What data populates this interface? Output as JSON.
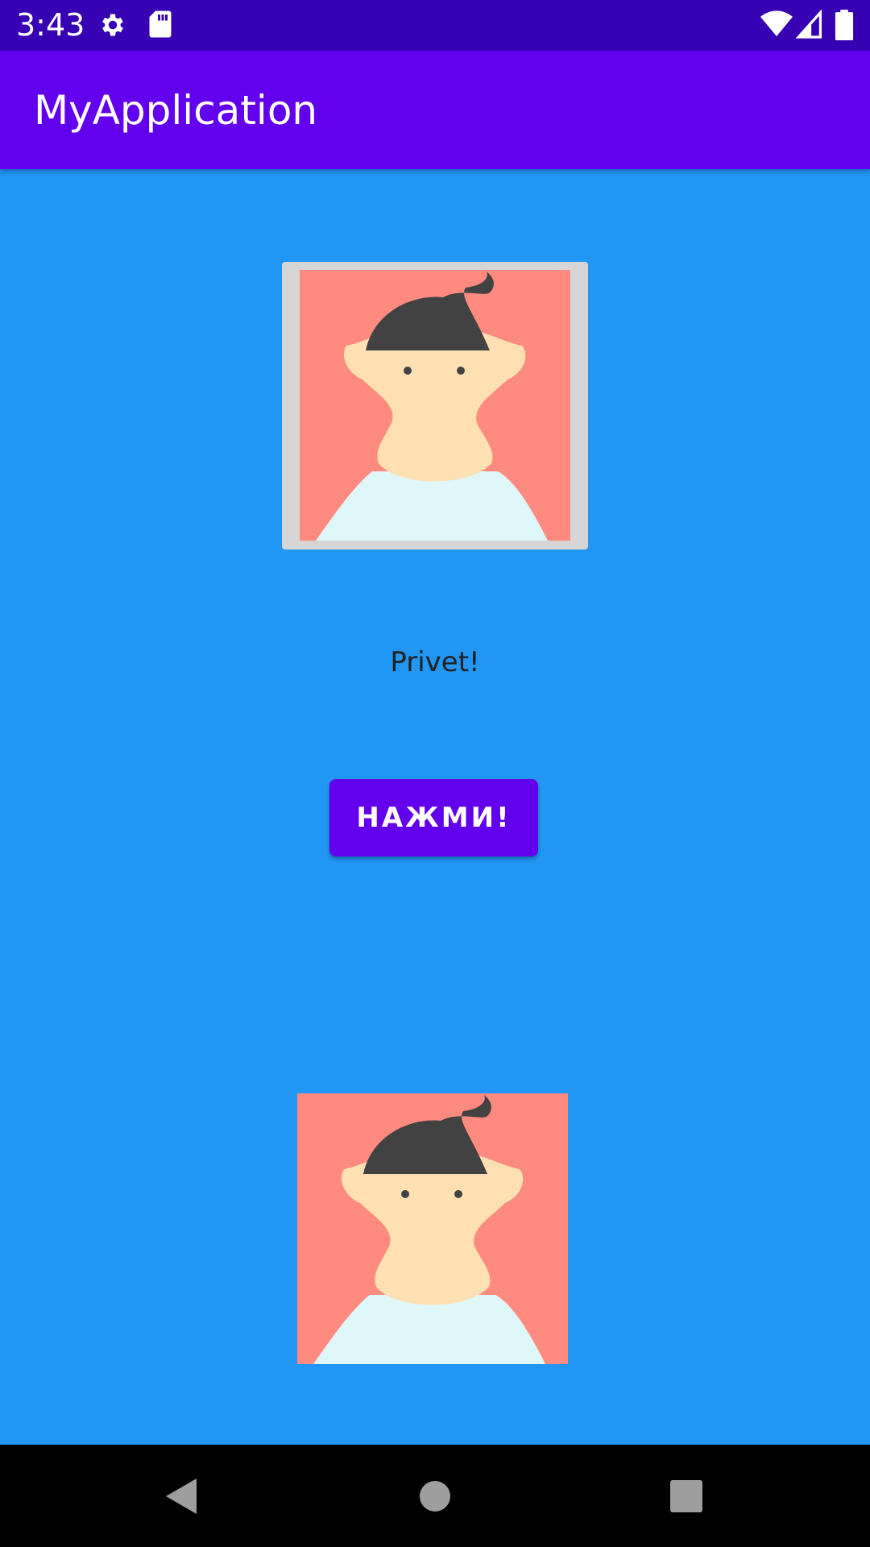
{
  "status_bar": {
    "time": "3:43",
    "icons": [
      "gear-icon",
      "sd-card-icon",
      "wifi-icon",
      "signal-icon",
      "battery-icon"
    ]
  },
  "app_bar": {
    "title": "MyApplication"
  },
  "content": {
    "greeting": "Privet!",
    "button_label": "НАЖМИ!"
  },
  "nav_bar": {
    "icons": [
      "back-icon",
      "home-icon",
      "recents-icon"
    ]
  },
  "colors": {
    "status_bar": "#3700B3",
    "app_bar": "#6200EE",
    "background": "#2196F3",
    "button": "#6200EE",
    "avatar_background": "#FF8A80"
  }
}
